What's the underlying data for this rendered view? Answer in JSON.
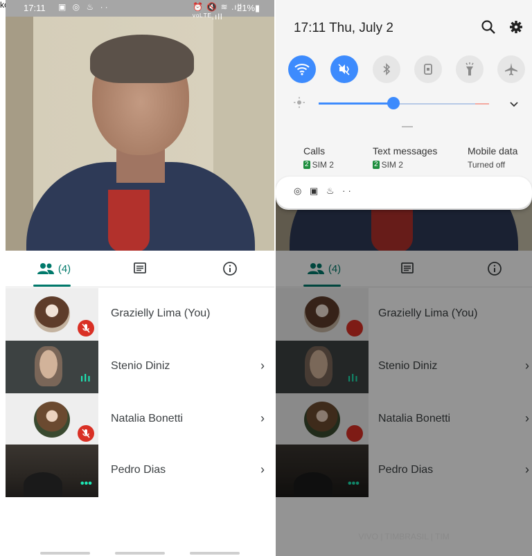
{
  "corner_label": "ko",
  "status_bar": {
    "time": "17:11",
    "left_icons": "▣ ◎ ♨ ··",
    "right_icons": "⏰ 🔇 ≋ .ıll ᵛᵒᴸᵀᴱ.ıll",
    "battery": "21%▮"
  },
  "call": {
    "tabs": {
      "people_count": "(4)"
    },
    "participants": [
      {
        "name": "Grazielly Lima (You)",
        "state": "muted"
      },
      {
        "name": "Stenio Diniz",
        "state": "speaking"
      },
      {
        "name": "Natalia Bonetti",
        "state": "muted"
      },
      {
        "name": "Pedro Dias",
        "state": "more"
      }
    ]
  },
  "shade": {
    "datetime": "17:11  Thu, July 2",
    "quick_settings": [
      {
        "icon": "wifi-icon",
        "on": true
      },
      {
        "icon": "mute-icon",
        "on": true
      },
      {
        "icon": "bluetooth-icon",
        "on": false
      },
      {
        "icon": "rotation-icon",
        "on": false
      },
      {
        "icon": "flashlight-icon",
        "on": false
      },
      {
        "icon": "airplane-icon",
        "on": false
      }
    ],
    "brightness": 0.44,
    "sims": [
      {
        "title": "Calls",
        "sim_badge": "2",
        "sim_label": "SIM 2"
      },
      {
        "title": "Text messages",
        "sim_badge": "2",
        "sim_label": "SIM 2"
      },
      {
        "title": "Mobile data",
        "sim_badge": "",
        "sim_label": "Turned off"
      }
    ],
    "notif_icons": "◎ ▣ ♨ ··",
    "carrier": "VIVO | TIMBRASIL | TIM"
  },
  "colors": {
    "accent": "#00796b",
    "mute": "#d93025",
    "toggle_on": "#3d8bfd"
  }
}
